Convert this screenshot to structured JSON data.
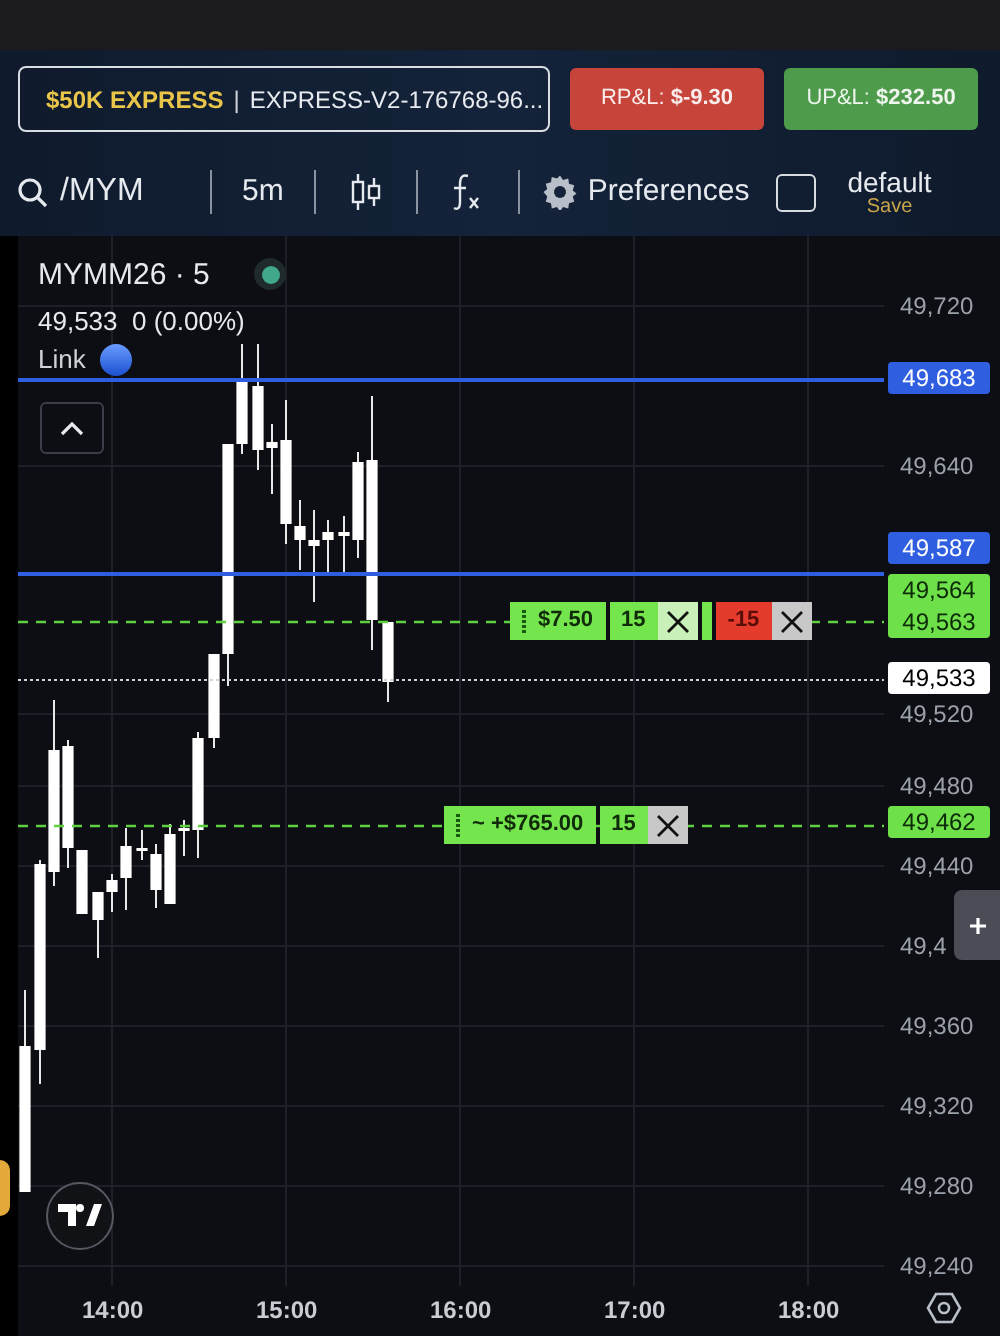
{
  "account_selector": {
    "account_type": "$50K EXPRESS",
    "separator": "|",
    "account_id": "EXPRESS-V2-176768-96..."
  },
  "pnl": [
    {
      "kind": "loss",
      "label": "RP&L:",
      "value": "$-9.30"
    },
    {
      "kind": "gain",
      "label": "UP&L:",
      "value": "$232.50"
    }
  ],
  "toolbar": {
    "symbol": "/MYM",
    "interval": "5m",
    "preferences": "Preferences",
    "layout": {
      "checked": false,
      "name": "default",
      "action": "Save"
    }
  },
  "chart": {
    "symbol": "MYMM26 · 5",
    "quote": "49,533  0 (0.00%)",
    "link": "Link",
    "price_axis": [
      "49,720",
      "49,640",
      "49,520",
      "49,480",
      "49,440",
      "49,4",
      "49,360",
      "49,320",
      "49,280",
      "49,240"
    ],
    "price_labels": [
      {
        "kind": "line",
        "texts": [
          "49,683"
        ]
      },
      {
        "kind": "line",
        "texts": [
          "49,587"
        ]
      },
      {
        "kind": "order",
        "texts": [
          "49,564",
          "49,563"
        ]
      },
      {
        "kind": "last",
        "texts": [
          "49,533"
        ]
      },
      {
        "kind": "order",
        "texts": [
          "49,462"
        ]
      }
    ],
    "order_tags": [
      {
        "segments": [
          {
            "kind": "pnl",
            "text": "$7.50"
          },
          {
            "kind": "qty",
            "text": "15"
          },
          {
            "kind": "cancel"
          },
          {
            "kind": "gap"
          },
          {
            "kind": "stop",
            "text": "-15"
          },
          {
            "kind": "close"
          }
        ]
      },
      {
        "segments": [
          {
            "kind": "pnl",
            "text": "~ +$765.00"
          },
          {
            "kind": "qty",
            "text": "15"
          },
          {
            "kind": "close"
          }
        ]
      }
    ],
    "time_axis": [
      "14:00",
      "15:00",
      "16:00",
      "17:00",
      "18:00"
    ]
  }
}
